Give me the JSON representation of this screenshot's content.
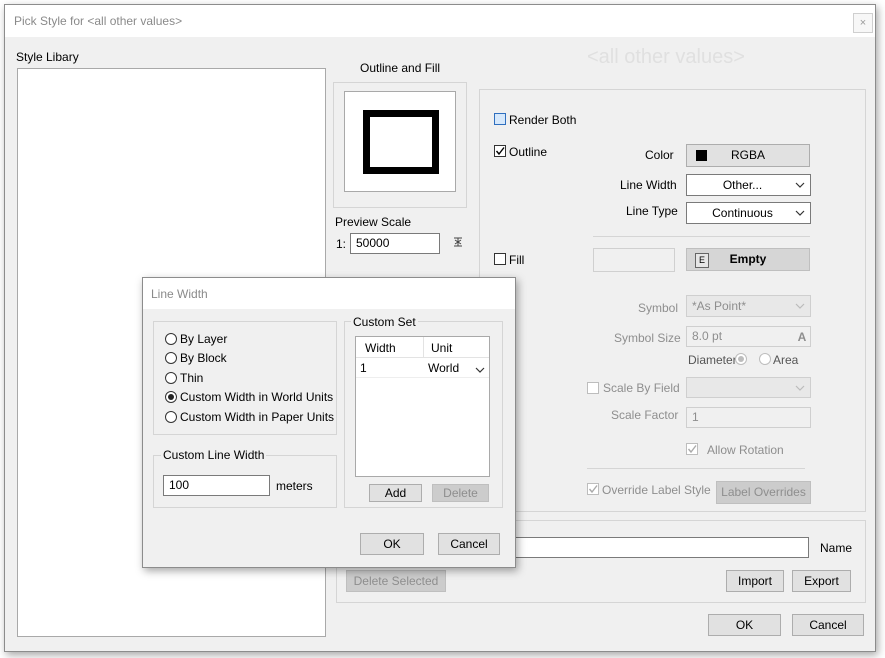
{
  "window": {
    "title": "Pick Style for <all other values>",
    "close_glyph": "×"
  },
  "background_heading": "<all other values>",
  "style_library": {
    "label": "Style Libary"
  },
  "outline_fill": {
    "label": "Outline and Fill"
  },
  "preview_scale": {
    "label": "Preview Scale",
    "prefix": "1:",
    "value": "50000"
  },
  "render_both": {
    "label": "Render Both",
    "checked": false
  },
  "outline": {
    "label": "Outline",
    "checked": true,
    "color_label": "Color",
    "color_button": "RGBA",
    "color_swatch": "#000000",
    "line_width_label": "Line Width",
    "line_width_value": "Other...",
    "line_type_label": "Line Type",
    "line_type_value": "Continuous"
  },
  "fill": {
    "label": "Fill",
    "checked": false,
    "empty_tag": "E",
    "empty_button": "Empty"
  },
  "symbol": {
    "label": "Symbol",
    "value": "*As Point*",
    "size_label": "Symbol Size",
    "size_value": "8.0 pt",
    "size_badge": "A",
    "diameter_label": "Diameter",
    "area_label": "Area"
  },
  "scale_by_field": {
    "label": "Scale By Field",
    "factor_label": "Scale Factor",
    "factor_value": "1"
  },
  "allow_rotation": {
    "label": "Allow Rotation"
  },
  "override_label": {
    "label": "Override Label Style",
    "button": "Label Overrides"
  },
  "name_label": "Name",
  "buttons": {
    "delete_selected": "Delete Selected",
    "import": "Import",
    "export": "Export",
    "ok": "OK",
    "cancel": "Cancel"
  },
  "line_width_dialog": {
    "title": "Line Width",
    "options": [
      {
        "label": "By Layer",
        "selected": false
      },
      {
        "label": "By Block",
        "selected": false
      },
      {
        "label": "Thin",
        "selected": false
      },
      {
        "label": "Custom Width in World Units",
        "selected": true
      },
      {
        "label": "Custom Width in Paper Units",
        "selected": false
      }
    ],
    "custom_line_width_label": "Custom Line Width",
    "custom_line_width_value": "100",
    "units": "meters",
    "custom_set": {
      "label": "Custom Set",
      "columns": [
        "Width",
        "Unit"
      ],
      "rows": [
        {
          "width": "1",
          "unit": "World"
        }
      ],
      "add": "Add",
      "delete": "Delete"
    },
    "ok": "OK",
    "cancel": "Cancel"
  }
}
